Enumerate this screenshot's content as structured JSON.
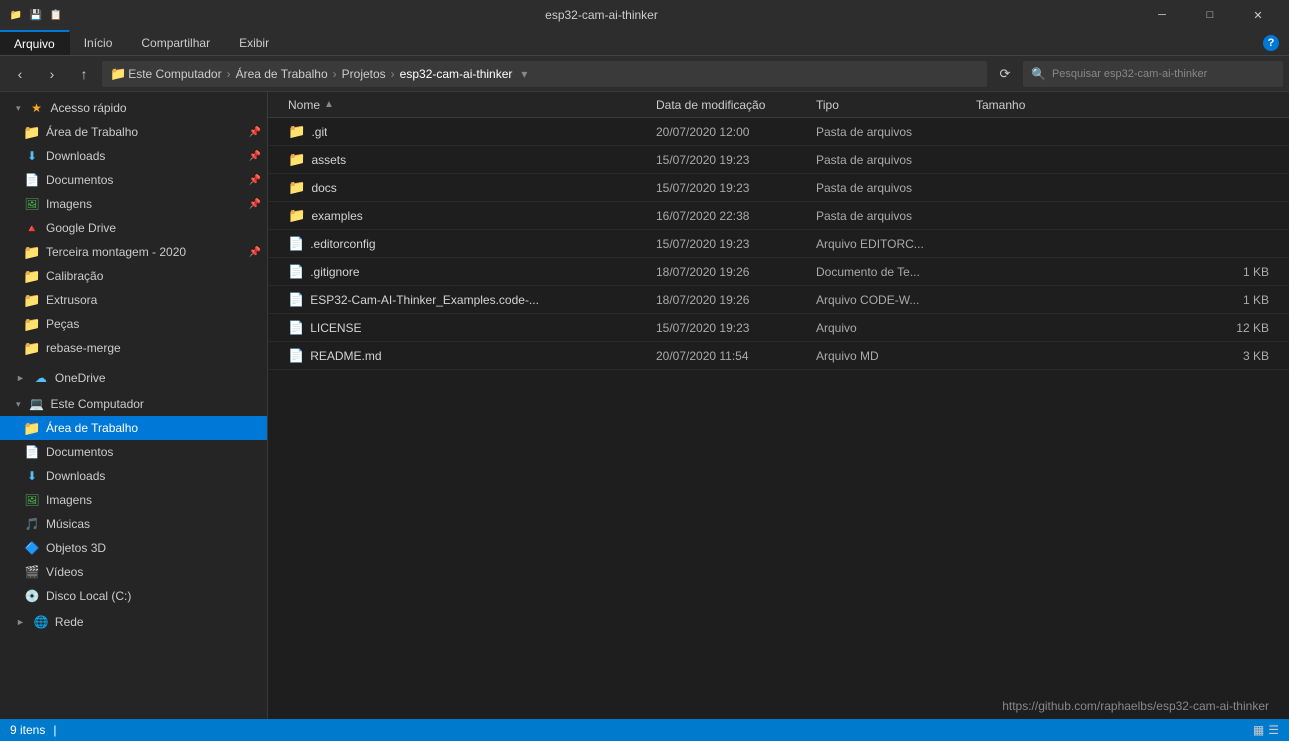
{
  "titlebar": {
    "icons": [
      "📁",
      "💾",
      "📋"
    ],
    "title": "esp32-cam-ai-thinker",
    "minimize": "─",
    "maximize": "□",
    "close": "✕"
  },
  "ribbon": {
    "tabs": [
      "Arquivo",
      "Início",
      "Compartilhar",
      "Exibir"
    ],
    "active_tab": "Arquivo",
    "help_icon": "?"
  },
  "navbar": {
    "back": "‹",
    "forward": "›",
    "up": "↑",
    "breadcrumb": {
      "items": [
        "Este Computador",
        "Área de Trabalho",
        "Projetos",
        "esp32-cam-ai-thinker"
      ]
    },
    "search_placeholder": "Pesquisar esp32-cam-ai-thinker"
  },
  "sidebar": {
    "quick_access_label": "Acesso rápido",
    "items_quick": [
      {
        "label": "Área de Trabalho",
        "icon": "folder",
        "pinned": true
      },
      {
        "label": "Downloads",
        "icon": "download",
        "pinned": true
      },
      {
        "label": "Documentos",
        "icon": "docs",
        "pinned": true
      },
      {
        "label": "Imagens",
        "icon": "images",
        "pinned": true
      },
      {
        "label": "Google Drive",
        "icon": "google",
        "pinned": false
      },
      {
        "label": "Terceira montagem - 2020",
        "icon": "folder-yellow",
        "pinned": true
      },
      {
        "label": "Calibração",
        "icon": "folder",
        "pinned": false
      },
      {
        "label": "Extrusora",
        "icon": "folder",
        "pinned": false
      },
      {
        "label": "Peças",
        "icon": "folder",
        "pinned": false
      },
      {
        "label": "rebase-merge",
        "icon": "folder",
        "pinned": false
      }
    ],
    "onedrive_label": "OneDrive",
    "computer_label": "Este Computador",
    "items_computer": [
      {
        "label": "Área de Trabalho",
        "icon": "folder-blue",
        "active": true
      },
      {
        "label": "Documentos",
        "icon": "docs"
      },
      {
        "label": "Downloads",
        "icon": "download"
      },
      {
        "label": "Imagens",
        "icon": "images"
      },
      {
        "label": "Músicas",
        "icon": "music"
      },
      {
        "label": "Objetos 3D",
        "icon": "3d"
      },
      {
        "label": "Vídeos",
        "icon": "video"
      },
      {
        "label": "Disco Local (C:)",
        "icon": "drive"
      }
    ],
    "network_label": "Rede"
  },
  "filelist": {
    "columns": {
      "name": "Nome",
      "date": "Data de modificação",
      "type": "Tipo",
      "size": "Tamanho"
    },
    "files": [
      {
        "name": ".git",
        "date": "20/07/2020 12:00",
        "type": "Pasta de arquivos",
        "size": "",
        "icon": "folder"
      },
      {
        "name": "assets",
        "date": "15/07/2020 19:23",
        "type": "Pasta de arquivos",
        "size": "",
        "icon": "folder"
      },
      {
        "name": "docs",
        "date": "15/07/2020 19:23",
        "type": "Pasta de arquivos",
        "size": "",
        "icon": "folder"
      },
      {
        "name": "examples",
        "date": "16/07/2020 22:38",
        "type": "Pasta de arquivos",
        "size": "",
        "icon": "folder"
      },
      {
        "name": ".editorconfig",
        "date": "15/07/2020 19:23",
        "type": "Arquivo EDITORC...",
        "size": "",
        "icon": "file"
      },
      {
        "name": ".gitignore",
        "date": "18/07/2020 19:26",
        "type": "Documento de Te...",
        "size": "1 KB",
        "icon": "file"
      },
      {
        "name": "ESP32-Cam-AI-Thinker_Examples.code-...",
        "date": "18/07/2020 19:26",
        "type": "Arquivo CODE-W...",
        "size": "1 KB",
        "icon": "file"
      },
      {
        "name": "LICENSE",
        "date": "15/07/2020 19:23",
        "type": "Arquivo",
        "size": "12 KB",
        "icon": "file"
      },
      {
        "name": "README.md",
        "date": "20/07/2020 11:54",
        "type": "Arquivo MD",
        "size": "3 KB",
        "icon": "file"
      }
    ]
  },
  "statusbar": {
    "count": "9 itens",
    "url": "https://github.com/raphaelbs/esp32-cam-ai-thinker",
    "view_icons": [
      "▦",
      "☰"
    ]
  }
}
